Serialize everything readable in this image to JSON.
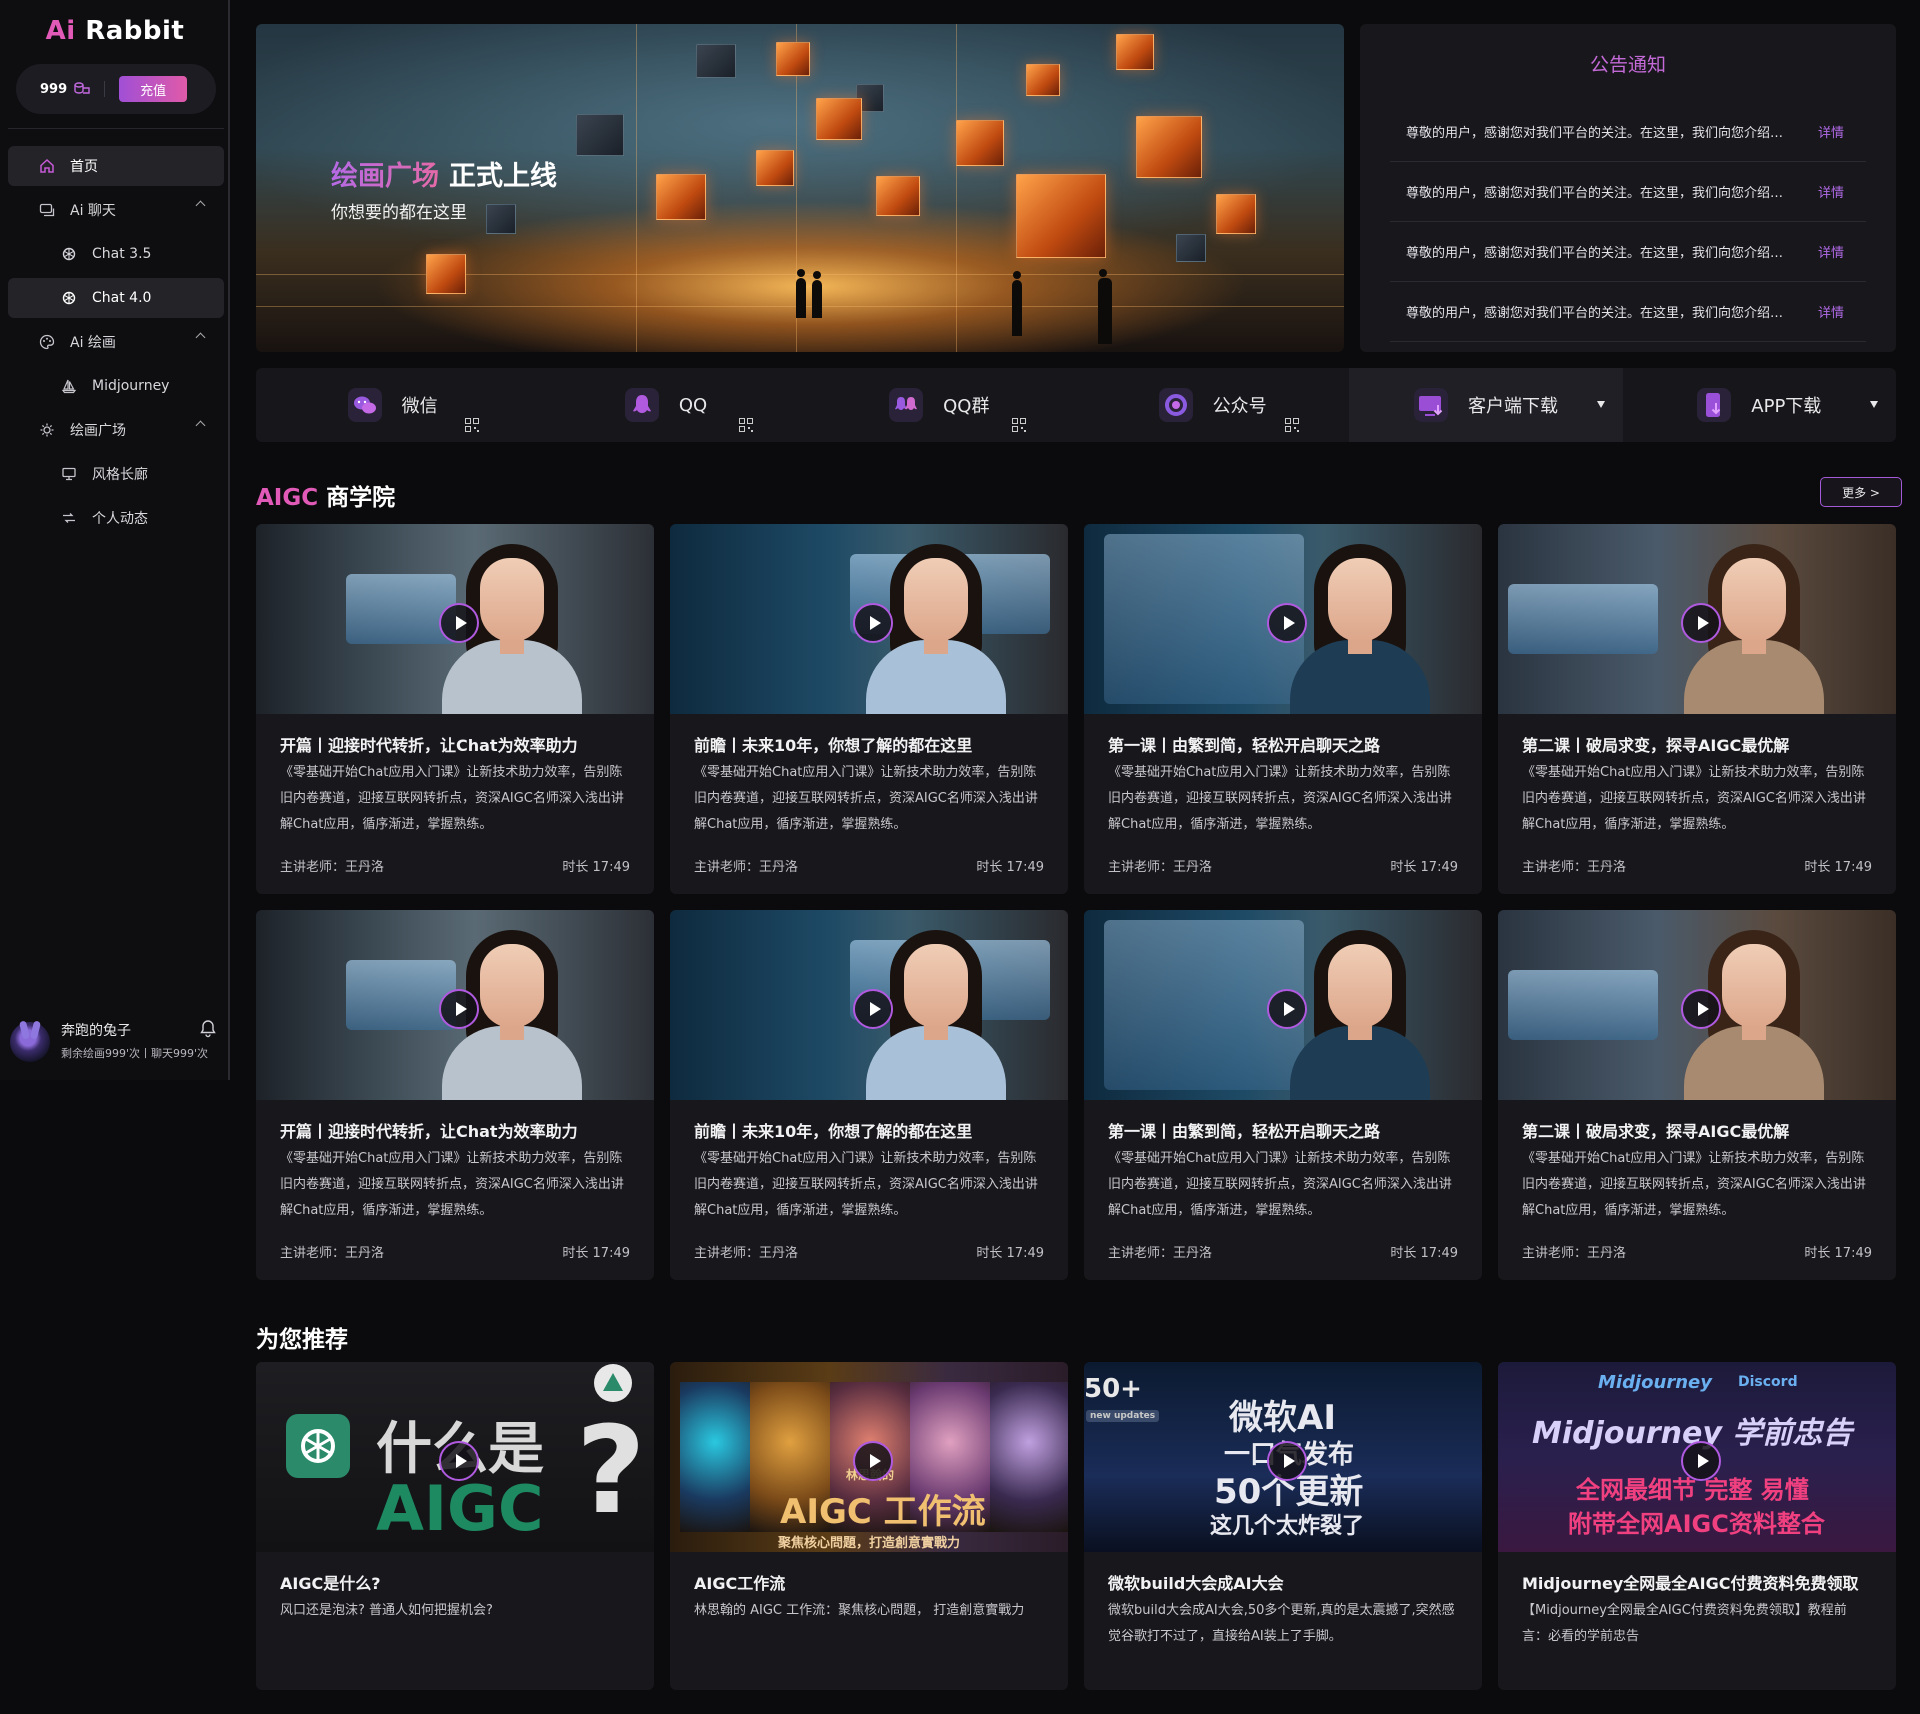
{
  "brand": {
    "ai": "Ai",
    "name": "Rabbit"
  },
  "credit": {
    "amount": "999",
    "topup_label": "充值"
  },
  "nav": {
    "home": "首页",
    "ai_chat": "Ai 聊天",
    "chat35": "Chat 3.5",
    "chat40": "Chat 4.0",
    "ai_paint": "Ai 绘画",
    "midjourney": "Midjourney",
    "square": "绘画广场",
    "gallery": "风格长廊",
    "activity": "个人动态"
  },
  "user": {
    "name": "奔跑的兔子",
    "quota": "剩余绘画999'次丨聊天999'次"
  },
  "banner": {
    "title_highlight": "绘画广场",
    "title_rest": "正式上线",
    "subtitle": "你想要的都在这里"
  },
  "notice": {
    "title": "公告通知",
    "items": [
      {
        "text": "尊敬的用户，感谢您对我们平台的关注。在这里，我们向您介绍我们的最新功能与服务",
        "more": "详情"
      },
      {
        "text": "尊敬的用户，感谢您对我们平台的关注。在这里，我们向您介绍我们的最新功能与服务",
        "more": "详情"
      },
      {
        "text": "尊敬的用户，感谢您对我们平台的关注。在这里，我们向您介绍我们的最新功能与服务",
        "more": "详情"
      },
      {
        "text": "尊敬的用户，感谢您对我们平台的关注。在这里，我们向您介绍我们的最新功能与服务",
        "more": "详情"
      }
    ]
  },
  "social": [
    {
      "label": "微信",
      "icon": "wechat-icon",
      "color": "#8a5ae0"
    },
    {
      "label": "QQ",
      "icon": "qq-icon",
      "color": "#a050d8"
    },
    {
      "label": "QQ群",
      "icon": "qq-group-icon",
      "color": "#b04fd0"
    },
    {
      "label": "公众号",
      "icon": "official-account-icon",
      "color": "#7a56d6"
    },
    {
      "label": "客户端下载",
      "icon": "desktop-download-icon",
      "color": "#a64ed6"
    },
    {
      "label": "APP下载",
      "icon": "mobile-download-icon",
      "color": "#9a50d8"
    }
  ],
  "academy": {
    "title_grad": "AIGC",
    "title_rest": " 商学院",
    "more": "更多 >"
  },
  "courses": [
    {
      "title": "开篇丨迎接时代转折，让Chat为效率助力",
      "desc": "《零基础开始Chat应用入门课》让新技术助力效率，告别陈旧内卷赛道，迎接互联网转折点，资深AIGC名师深入浅出讲解Chat应用，循序渐进，掌握熟练。",
      "teacher": "主讲老师：王丹洛",
      "duration": "时长  17:49"
    },
    {
      "title": "前瞻丨未来10年，你想了解的都在这里",
      "desc": "《零基础开始Chat应用入门课》让新技术助力效率，告别陈旧内卷赛道，迎接互联网转折点，资深AIGC名师深入浅出讲解Chat应用，循序渐进，掌握熟练。",
      "teacher": "主讲老师：王丹洛",
      "duration": "时长  17:49"
    },
    {
      "title": "第一课丨由繁到简，轻松开启聊天之路",
      "desc": "《零基础开始Chat应用入门课》让新技术助力效率，告别陈旧内卷赛道，迎接互联网转折点，资深AIGC名师深入浅出讲解Chat应用，循序渐进，掌握熟练。",
      "teacher": "主讲老师：王丹洛",
      "duration": "时长  17:49"
    },
    {
      "title": "第二课丨破局求变，探寻AIGC最优解",
      "desc": "《零基础开始Chat应用入门课》让新技术助力效率，告别陈旧内卷赛道，迎接互联网转折点，资深AIGC名师深入浅出讲解Chat应用，循序渐进，掌握熟练。",
      "teacher": "主讲老师：王丹洛",
      "duration": "时长  17:49"
    },
    {
      "title": "开篇丨迎接时代转折，让Chat为效率助力",
      "desc": "《零基础开始Chat应用入门课》让新技术助力效率，告别陈旧内卷赛道，迎接互联网转折点，资深AIGC名师深入浅出讲解Chat应用，循序渐进，掌握熟练。",
      "teacher": "主讲老师：王丹洛",
      "duration": "时长  17:49"
    },
    {
      "title": "前瞻丨未来10年，你想了解的都在这里",
      "desc": "《零基础开始Chat应用入门课》让新技术助力效率，告别陈旧内卷赛道，迎接互联网转折点，资深AIGC名师深入浅出讲解Chat应用，循序渐进，掌握熟练。",
      "teacher": "主讲老师：王丹洛",
      "duration": "时长  17:49"
    },
    {
      "title": "第一课丨由繁到简，轻松开启聊天之路",
      "desc": "《零基础开始Chat应用入门课》让新技术助力效率，告别陈旧内卷赛道，迎接互联网转折点，资深AIGC名师深入浅出讲解Chat应用，循序渐进，掌握熟练。",
      "teacher": "主讲老师：王丹洛",
      "duration": "时长  17:49"
    },
    {
      "title": "第二课丨破局求变，探寻AIGC最优解",
      "desc": "《零基础开始Chat应用入门课》让新技术助力效率，告别陈旧内卷赛道，迎接互联网转折点，资深AIGC名师深入浅出讲解Chat应用，循序渐进，掌握熟练。",
      "teacher": "主讲老师：王丹洛",
      "duration": "时长  17:49"
    }
  ],
  "recommend": {
    "title": "为您推荐",
    "items": [
      {
        "title": "AIGC是什么?",
        "desc": "风口还是泡沫? 普通人如何把握机会?",
        "art_l1": "什么是",
        "art_l2": "AIGC",
        "art_q": "?"
      },
      {
        "title": "AIGC工作流",
        "desc": "林思翰的 AIGC 工作流：聚焦核心問題， 打造創意實戰力",
        "art_l1": "AIGC 工作流",
        "art_l2": "聚焦核心問題，打造創意實戰力",
        "art_tag": "林思翰的"
      },
      {
        "title": "微软build大会成AI大会",
        "desc": "微软build大会成AI大会,50多个更新,真的是太震撼了,突然感觉谷歌打不过了，直接给AI装上了手脚。",
        "art_l1": "微软AI",
        "art_l2": "一口气发布",
        "art_l3": "50个更新",
        "art_l4": "这几个太炸裂了",
        "art_badge": "50+",
        "art_badge2": "new updates"
      },
      {
        "title": "Midjourney全网最全AIGC付费资料免费领取",
        "desc": "【Midjourney全网最全AIGC付费资料免费领取】教程前言：必看的学前忠告",
        "art_top": "Midjourney",
        "art_discord": "Discord",
        "art_l1": "Midjourney 学前忠告",
        "art_l2": "全网最细节 完整 易懂",
        "art_l3": "附带全网AIGC资料整合"
      }
    ]
  }
}
